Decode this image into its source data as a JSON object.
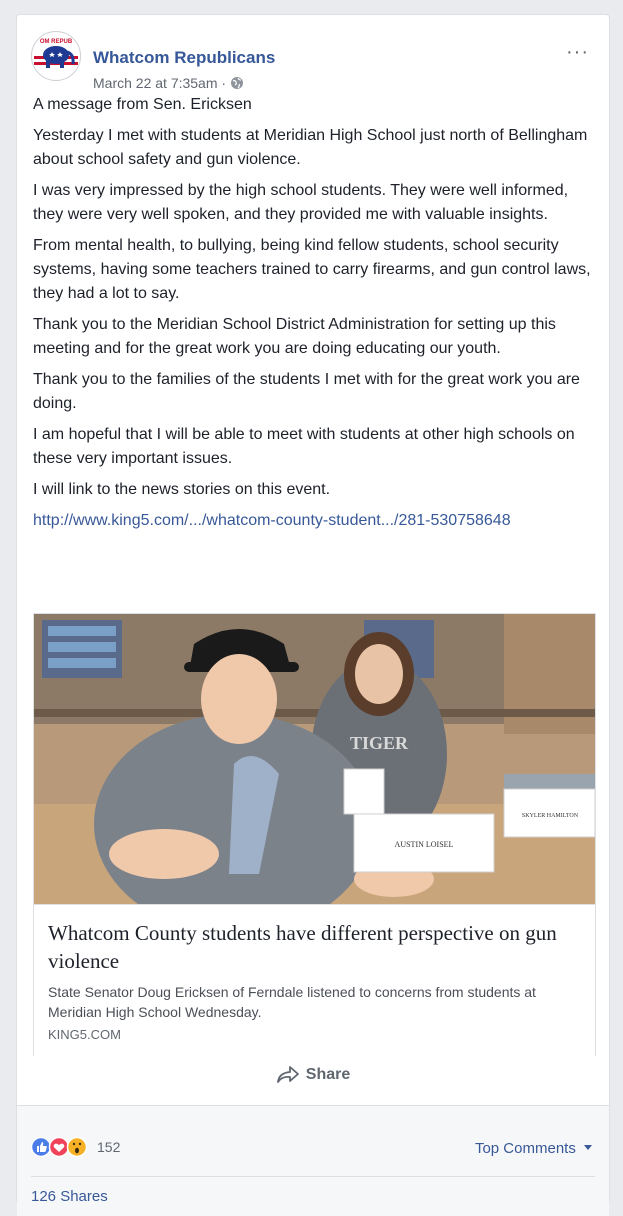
{
  "post": {
    "page_name": "Whatcom Republicans",
    "date": "March 22 at 7:35am",
    "separator": " · ",
    "more_label": "···",
    "avatar_text": "OM REPUB",
    "paragraphs": [
      "A message from Sen. Ericksen",
      "Yesterday I met with students at Meridian High School just north of Bellingham about school safety and gun violence.",
      "I was very impressed by the high school students. They were well informed, they were very well spoken, and they provided me with valuable insights.",
      "From mental health, to bullying, being kind fellow students, school security systems, having some teachers trained to carry firearms, and gun control laws, they had a lot to say.",
      "Thank you to the Meridian School District Administration for setting up this meeting and for the great work you are doing educating our youth.",
      "Thank you to the families of the students I met with for the great work you are doing.",
      "I am hopeful that I will be able to meet with students at other high schools on these very important issues.",
      "I will link to the news stories on this event."
    ],
    "link_text": "http://www.king5.com/.../whatcom-county-student.../281-530758648"
  },
  "preview": {
    "image_labels": {
      "name_card_1": "AUSTIN LOISEL",
      "name_card_2": "SKYLER HAMILTON",
      "shirt_text": "TIGER"
    },
    "title": "Whatcom County students have different perspective on gun violence",
    "description": "State Senator Doug Ericksen of Ferndale listened to concerns from students at Meridian High School Wednesday.",
    "domain": "KING5.COM"
  },
  "actions": {
    "share_label": "Share"
  },
  "footer": {
    "reaction_count": "152",
    "reaction_icons": [
      "like-icon",
      "love-icon",
      "wow-icon"
    ],
    "top_comments_label": "Top Comments",
    "shares_label": "126 Shares"
  },
  "colors": {
    "link": "#385898",
    "page_name": "#365899",
    "text": "#1d2129",
    "like": "#4a7de8",
    "love": "#f0435a",
    "wow": "#f7b125"
  }
}
